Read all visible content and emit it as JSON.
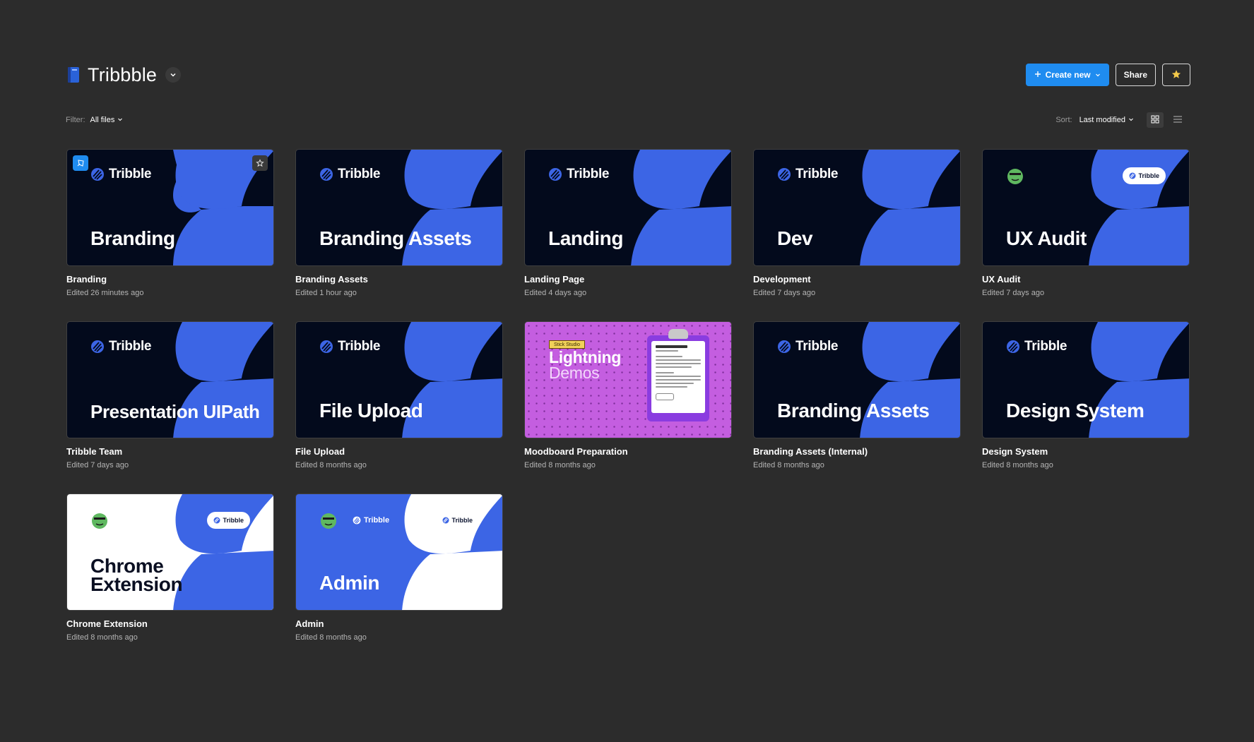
{
  "project": {
    "title": "Tribbble"
  },
  "header": {
    "create_label": "Create new",
    "share_label": "Share"
  },
  "toolbar": {
    "filter_label": "Filter:",
    "filter_value": "All files",
    "sort_label": "Sort:",
    "sort_value": "Last modified"
  },
  "colors": {
    "accent": "#1f8cf0",
    "brand_blue": "#3c65e5",
    "dark_navy": "#030a1c",
    "background": "#2c2c2c"
  },
  "files": [
    {
      "name": "Branding",
      "edited": "Edited 26 minutes ago",
      "thumb_title": "Branding",
      "brand": "Tribble"
    },
    {
      "name": "Branding Assets",
      "edited": "Edited 1 hour ago",
      "thumb_title": "Branding Assets",
      "brand": "Tribble"
    },
    {
      "name": "Landing Page",
      "edited": "Edited 4 days ago",
      "thumb_title": "Landing",
      "brand": "Tribble"
    },
    {
      "name": "Development",
      "edited": "Edited 7 days ago",
      "thumb_title": "Dev",
      "brand": "Tribble"
    },
    {
      "name": "UX Audit",
      "edited": "Edited 7 days ago",
      "thumb_title": "UX Audit",
      "pill": "Tribble"
    },
    {
      "name": "Tribble Team",
      "edited": "Edited 7 days ago",
      "thumb_title": "Presentation UIPath",
      "brand": "Tribble"
    },
    {
      "name": "File Upload",
      "edited": "Edited 8 months ago",
      "thumb_title": "File Upload",
      "brand": "Tribble"
    },
    {
      "name": "Moodboard Preparation",
      "edited": "Edited 8 months ago",
      "thumb_title": "Lightning",
      "thumb_subtitle": "Demos",
      "tag": "Stick Studio"
    },
    {
      "name": "Branding Assets (Internal)",
      "edited": "Edited 8 months ago",
      "thumb_title": "Branding Assets",
      "brand": "Tribble"
    },
    {
      "name": "Design System",
      "edited": "Edited 8 months ago",
      "thumb_title": "Design System",
      "brand": "Tribble"
    },
    {
      "name": "Chrome Extension",
      "edited": "Edited 8 months ago",
      "thumb_title_1": "Chrome",
      "thumb_title_2": "Extension",
      "pill": "Tribble"
    },
    {
      "name": "Admin",
      "edited": "Edited 8 months ago",
      "thumb_title": "Admin",
      "brand": "Tribble",
      "pill": "Tribble"
    }
  ]
}
